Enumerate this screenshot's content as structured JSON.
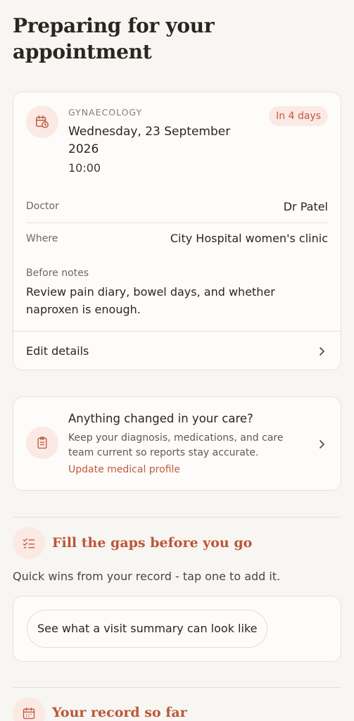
{
  "page": {
    "title": "Preparing for your appointment"
  },
  "appointment": {
    "specialty": "GYNAECOLOGY",
    "badge": "In 4 days",
    "date": "Wednesday, 23 September 2026",
    "time": "10:00",
    "doctor_label": "Doctor",
    "doctor_value": "Dr Patel",
    "where_label": "Where",
    "where_value": "City Hospital women's clinic",
    "notes_label": "Before notes",
    "notes_text": "Review pain diary, bowel days, and whether naproxen is enough.",
    "edit_label": "Edit details",
    "icon": "calendar-clock-icon"
  },
  "care_prompt": {
    "title": "Anything changed in your care?",
    "description": "Keep your diagnosis, medications, and care team current so reports stay accurate.",
    "link": "Update medical profile",
    "icon": "clipboard-icon"
  },
  "gaps": {
    "title": "Fill the gaps before you go",
    "subtitle": "Quick wins from your record - tap one to add it.",
    "chips": [
      "See what a visit summary can look like"
    ],
    "icon": "checklist-icon"
  },
  "record": {
    "title": "Your record so far",
    "icon": "calendar-icon"
  },
  "colors": {
    "accent": "#c05a3f",
    "accent_bg": "#fbe9e3",
    "background": "#f8f6f2",
    "card": "#fdfcfa"
  }
}
